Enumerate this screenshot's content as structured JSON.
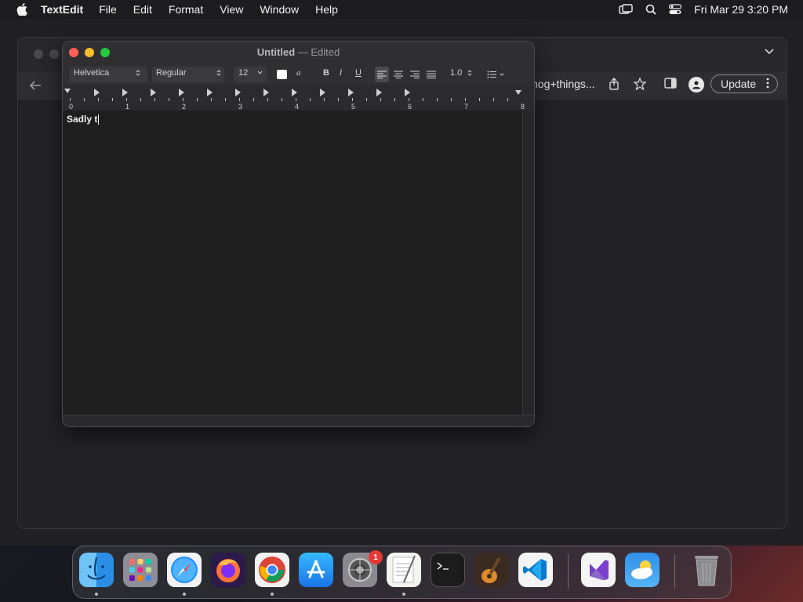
{
  "menubar": {
    "app_name": "TextEdit",
    "items": [
      "File",
      "Edit",
      "Format",
      "View",
      "Window",
      "Help"
    ],
    "clock": "Fri Mar 29  3:20 PM"
  },
  "chrome": {
    "address_tail": "nog+things...",
    "update_label": "Update"
  },
  "textedit": {
    "title": "Untitled",
    "title_sep": " — ",
    "title_status": "Edited",
    "font_family": "Helvetica",
    "font_style": "Regular",
    "font_size": "12",
    "bold": "B",
    "italic": "I",
    "underline": "U",
    "line_spacing": "1.0",
    "ruler_labels": [
      "0",
      "1",
      "2",
      "3",
      "4",
      "5",
      "6",
      "7",
      "8"
    ],
    "document_text": "Sadly t"
  },
  "dock": {
    "apps": [
      "finder",
      "launchpad",
      "safari",
      "firefox",
      "chrome",
      "app-store",
      "system-settings",
      "textedit",
      "terminal",
      "garageband",
      "vscode",
      "visual-studio",
      "weather",
      "trash"
    ],
    "system_settings_badge": "1"
  },
  "colors": {
    "close": "#ff5f57",
    "minimize": "#febc2e",
    "zoom": "#28c840"
  }
}
